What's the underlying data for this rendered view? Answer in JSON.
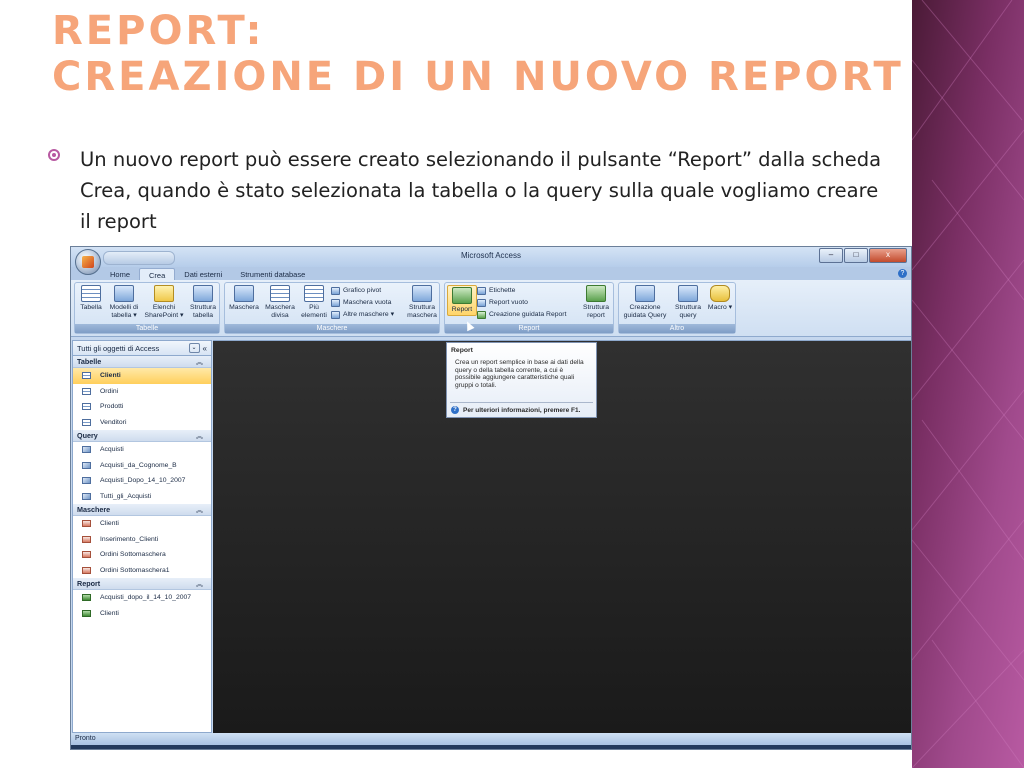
{
  "slide": {
    "title_line1": "Report:",
    "title_line2": "creazione di un nuovo report",
    "bullet_text": "Un nuovo report può essere creato selezionando il pulsante “Report” dalla scheda Crea, quando è stato selezionata la tabella o la query sulla quale vogliamo creare il report",
    "colors": {
      "title": "#f6a57a",
      "accent": "#b85aa2",
      "side_band": "#7a2f64"
    }
  },
  "access": {
    "window_title": "Microsoft Access",
    "window_controls": {
      "minimize": "–",
      "maximize": "□",
      "close": "x"
    },
    "tabs": [
      "Home",
      "Crea",
      "Dati esterni",
      "Strumenti database"
    ],
    "active_tab": "Crea",
    "help_icon": "?",
    "ribbon": {
      "groups": {
        "tabelle": {
          "label": "Tabelle",
          "buttons": [
            "Tabella",
            "Modelli di tabella ▾",
            "Elenchi SharePoint ▾",
            "Struttura tabella"
          ]
        },
        "maschere": {
          "label": "Maschere",
          "buttons": [
            "Maschera",
            "Maschera divisa",
            "Più elementi",
            "Struttura maschera"
          ],
          "small": [
            "Grafico pivot",
            "Maschera vuota",
            "Altre maschere ▾"
          ]
        },
        "report": {
          "label": "Report",
          "buttons": [
            "Report",
            "Struttura report"
          ],
          "small": [
            "Etichette",
            "Report vuoto",
            "Creazione guidata Report"
          ]
        },
        "altro": {
          "label": "Altro",
          "buttons": [
            "Creazione guidata Query",
            "Struttura query",
            "Macro ▾"
          ]
        }
      }
    },
    "nav_pane": {
      "header": "Tutti gli oggetti di Access",
      "dropdown": "⌄",
      "collapse": "«",
      "sections": [
        {
          "title": "Tabelle",
          "items": [
            "Clienti",
            "Ordini",
            "Prodotti",
            "Venditori"
          ]
        },
        {
          "title": "Query",
          "items": [
            "Acquisti",
            "Acquisti_da_Cognome_B",
            "Acquisti_Dopo_14_10_2007",
            "Tutti_gli_Acquisti"
          ]
        },
        {
          "title": "Maschere",
          "items": [
            "Clienti",
            "Inserimento_Clienti",
            "Ordini Sottomaschera",
            "Ordini Sottomaschera1"
          ]
        },
        {
          "title": "Report",
          "items": [
            "Acquisti_dopo_il_14_10_2007",
            "Clienti"
          ]
        }
      ],
      "collapse_chevron": "»"
    },
    "tooltip": {
      "title": "Report",
      "body": "Crea un report semplice in base ai dati della query o della tabella corrente, a cui è possibile aggiungere caratteristiche quali gruppi o totali.",
      "help": "Per ulteriori informazioni, premere F1.",
      "help_icon": "?"
    },
    "status": "Pronto"
  }
}
